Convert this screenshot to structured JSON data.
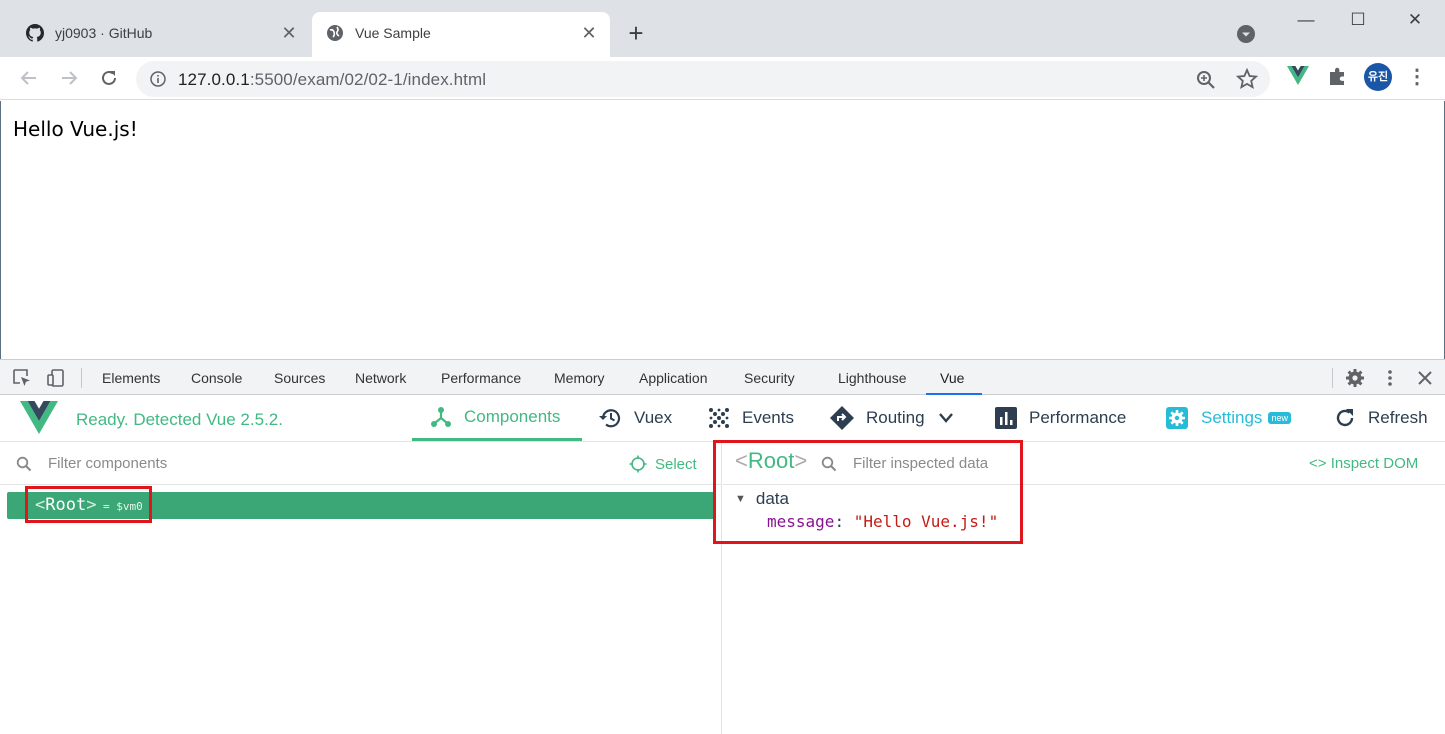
{
  "browser": {
    "tabs": [
      {
        "title": "yj0903 · GitHub",
        "icon": "github-icon",
        "active": false
      },
      {
        "title": "Vue Sample",
        "icon": "globe-icon",
        "active": true
      }
    ],
    "new_tab_symbol": "+",
    "tab_close_symbol": "✕",
    "window_controls": {
      "minimize": "—",
      "maximize": "☐",
      "close": "✕"
    },
    "address": {
      "host": "127.0.0.1",
      "rest": ":5500/exam/02/02-1/index.html"
    },
    "profile_initials": "유진"
  },
  "page": {
    "text": "Hello Vue.js!"
  },
  "devtools": {
    "tabs": [
      "Elements",
      "Console",
      "Sources",
      "Network",
      "Performance",
      "Memory",
      "Application",
      "Security",
      "Lighthouse",
      "Vue"
    ],
    "active_tab": "Vue"
  },
  "vue": {
    "status": "Ready. Detected Vue 2.5.2.",
    "nav": {
      "components": "Components",
      "vuex": "Vuex",
      "events": "Events",
      "routing": "Routing",
      "performance": "Performance",
      "settings": "Settings",
      "settings_badge": "new",
      "refresh": "Refresh"
    },
    "left": {
      "filter_placeholder": "Filter components",
      "select_label": "Select",
      "root_tag": "Root",
      "root_vm": "= $vm0"
    },
    "right": {
      "root_title": "Root",
      "filter_placeholder": "Filter inspected data",
      "inspect_dom": "Inspect DOM",
      "section": "data",
      "prop_key": "message",
      "prop_value": "\"Hello Vue.js!\""
    }
  },
  "colors": {
    "vue_green": "#42b983",
    "highlight_red": "#e0161c",
    "settings_cyan": "#26bcd8"
  }
}
